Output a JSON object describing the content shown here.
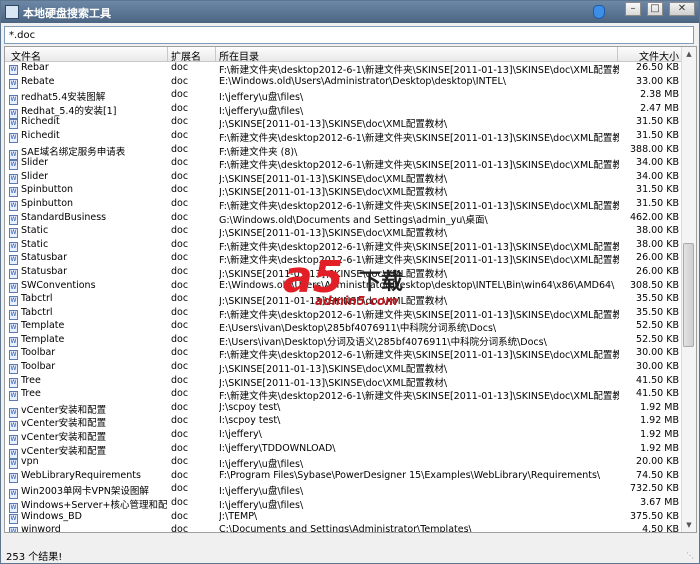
{
  "window": {
    "title": "本地硬盘搜索工具"
  },
  "search": {
    "value": "*.doc"
  },
  "columns": {
    "name": "文件名",
    "ext": "扩展名",
    "dir": "所在目录",
    "size": "文件大小"
  },
  "rows": [
    {
      "name": "Rebar",
      "ext": "doc",
      "dir": "F:\\新建文件夹\\desktop2012-6-1\\新建文件夹\\SKINSE[2011-01-13]\\SKINSE\\doc\\XML配置教材\\",
      "size": "26.50 KB"
    },
    {
      "name": "Rebate",
      "ext": "doc",
      "dir": "E:\\Windows.old\\Users\\Administrator\\Desktop\\desktop\\INTEL\\",
      "size": "33.00 KB"
    },
    {
      "name": "redhat5.4安装图解",
      "ext": "doc",
      "dir": "I:\\jeffery\\u盘\\files\\",
      "size": "2.38 MB"
    },
    {
      "name": "Redhat_5.4的安装[1]",
      "ext": "doc",
      "dir": "I:\\jeffery\\u盘\\files\\",
      "size": "2.47 MB"
    },
    {
      "name": "Richedit",
      "ext": "doc",
      "dir": "J:\\SKINSE[2011-01-13]\\SKINSE\\doc\\XML配置教材\\",
      "size": "31.50 KB"
    },
    {
      "name": "Richedit",
      "ext": "doc",
      "dir": "F:\\新建文件夹\\desktop2012-6-1\\新建文件夹\\SKINSE[2011-01-13]\\SKINSE\\doc\\XML配置教材\\",
      "size": "31.50 KB"
    },
    {
      "name": "SAE域名绑定服务申请表",
      "ext": "doc",
      "dir": "F:\\新建文件夹 (8)\\",
      "size": "388.00 KB"
    },
    {
      "name": "Slider",
      "ext": "doc",
      "dir": "F:\\新建文件夹\\desktop2012-6-1\\新建文件夹\\SKINSE[2011-01-13]\\SKINSE\\doc\\XML配置教材\\",
      "size": "34.00 KB"
    },
    {
      "name": "Slider",
      "ext": "doc",
      "dir": "J:\\SKINSE[2011-01-13]\\SKINSE\\doc\\XML配置教材\\",
      "size": "34.00 KB"
    },
    {
      "name": "Spinbutton",
      "ext": "doc",
      "dir": "J:\\SKINSE[2011-01-13]\\SKINSE\\doc\\XML配置教材\\",
      "size": "31.50 KB"
    },
    {
      "name": "Spinbutton",
      "ext": "doc",
      "dir": "F:\\新建文件夹\\desktop2012-6-1\\新建文件夹\\SKINSE[2011-01-13]\\SKINSE\\doc\\XML配置教材\\",
      "size": "31.50 KB"
    },
    {
      "name": "StandardBusiness",
      "ext": "doc",
      "dir": "G:\\Windows.old\\Documents and Settings\\admin_yu\\桌面\\",
      "size": "462.00 KB"
    },
    {
      "name": "Static",
      "ext": "doc",
      "dir": "J:\\SKINSE[2011-01-13]\\SKINSE\\doc\\XML配置教材\\",
      "size": "38.00 KB"
    },
    {
      "name": "Static",
      "ext": "doc",
      "dir": "F:\\新建文件夹\\desktop2012-6-1\\新建文件夹\\SKINSE[2011-01-13]\\SKINSE\\doc\\XML配置教材\\",
      "size": "38.00 KB"
    },
    {
      "name": "Statusbar",
      "ext": "doc",
      "dir": "F:\\新建文件夹\\desktop2012-6-1\\新建文件夹\\SKINSE[2011-01-13]\\SKINSE\\doc\\XML配置教材\\",
      "size": "26.00 KB"
    },
    {
      "name": "Statusbar",
      "ext": "doc",
      "dir": "J:\\SKINSE[2011-01-13]\\SKINSE\\doc\\XML配置教材\\",
      "size": "26.00 KB"
    },
    {
      "name": "SWConventions",
      "ext": "doc",
      "dir": "E:\\Windows.old\\Users\\Administrator\\Desktop\\desktop\\INTEL\\Bin\\win64\\x86\\AMD64\\",
      "size": "308.50 KB"
    },
    {
      "name": "Tabctrl",
      "ext": "doc",
      "dir": "J:\\SKINSE[2011-01-13]\\SKINSE\\doc\\XML配置教材\\",
      "size": "35.50 KB"
    },
    {
      "name": "Tabctrl",
      "ext": "doc",
      "dir": "F:\\新建文件夹\\desktop2012-6-1\\新建文件夹\\SKINSE[2011-01-13]\\SKINSE\\doc\\XML配置教材\\",
      "size": "35.50 KB"
    },
    {
      "name": "Template",
      "ext": "doc",
      "dir": "E:\\Users\\ivan\\Desktop\\285bf4076911\\中科院分词系统\\Docs\\",
      "size": "52.50 KB"
    },
    {
      "name": "Template",
      "ext": "doc",
      "dir": "E:\\Users\\ivan\\Desktop\\分词及语义\\285bf4076911\\中科院分词系统\\Docs\\",
      "size": "52.50 KB"
    },
    {
      "name": "Toolbar",
      "ext": "doc",
      "dir": "F:\\新建文件夹\\desktop2012-6-1\\新建文件夹\\SKINSE[2011-01-13]\\SKINSE\\doc\\XML配置教材\\",
      "size": "30.00 KB"
    },
    {
      "name": "Toolbar",
      "ext": "doc",
      "dir": "J:\\SKINSE[2011-01-13]\\SKINSE\\doc\\XML配置教材\\",
      "size": "30.00 KB"
    },
    {
      "name": "Tree",
      "ext": "doc",
      "dir": "J:\\SKINSE[2011-01-13]\\SKINSE\\doc\\XML配置教材\\",
      "size": "41.50 KB"
    },
    {
      "name": "Tree",
      "ext": "doc",
      "dir": "F:\\新建文件夹\\desktop2012-6-1\\新建文件夹\\SKINSE[2011-01-13]\\SKINSE\\doc\\XML配置教材\\",
      "size": "41.50 KB"
    },
    {
      "name": "vCenter安装和配置",
      "ext": "doc",
      "dir": "J:\\scpoy test\\",
      "size": "1.92 MB"
    },
    {
      "name": "vCenter安装和配置",
      "ext": "doc",
      "dir": "I:\\scpoy test\\",
      "size": "1.92 MB"
    },
    {
      "name": "vCenter安装和配置",
      "ext": "doc",
      "dir": "I:\\jeffery\\",
      "size": "1.92 MB"
    },
    {
      "name": "vCenter安装和配置",
      "ext": "doc",
      "dir": "I:\\jeffery\\TDDOWNLOAD\\",
      "size": "1.92 MB"
    },
    {
      "name": "vpn",
      "ext": "doc",
      "dir": "I:\\jeffery\\u盘\\files\\",
      "size": "20.00 KB"
    },
    {
      "name": "WebLibraryRequirements",
      "ext": "doc",
      "dir": "F:\\Program Files\\Sybase\\PowerDesigner 15\\Examples\\WebLibrary\\Requirements\\",
      "size": "74.50 KB"
    },
    {
      "name": "Win2003单网卡VPN架设图解",
      "ext": "doc",
      "dir": "I:\\jeffery\\u盘\\files\\",
      "size": "732.50 KB"
    },
    {
      "name": "Windows+Server+核心管理和配...",
      "ext": "doc",
      "dir": "I:\\jeffery\\u盘\\files\\",
      "size": "3.67 MB"
    },
    {
      "name": "Windows_BD",
      "ext": "doc",
      "dir": "J:\\TEMP\\",
      "size": "375.50 KB"
    },
    {
      "name": "winword",
      "ext": "doc",
      "dir": "C:\\Documents and Settings\\Administrator\\Templates\\",
      "size": "4.50 KB"
    }
  ],
  "status": {
    "text": "253 个结果!"
  },
  "watermark": {
    "brand": "a5",
    "label": "下载",
    "url": "admin5.com"
  },
  "icons": {
    "file": "word-doc-icon",
    "shield": "shield-icon"
  },
  "colors": {
    "titlebar": "#4a6482",
    "watermark": "#e21f26"
  }
}
